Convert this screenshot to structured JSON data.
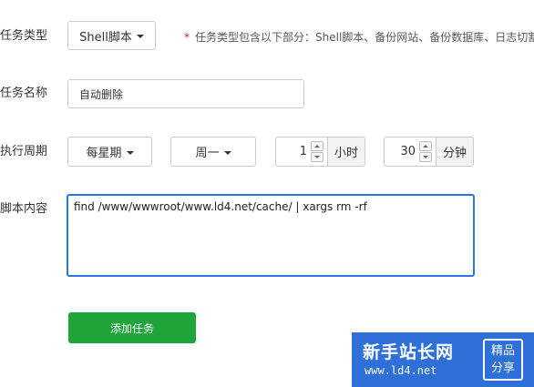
{
  "form": {
    "task_type": {
      "label": "任务类型",
      "value": "Shell脚本",
      "hint_star": "*",
      "hint": "任务类型包含以下部分：Shell脚本、备份网站、备份数据库、日志切割"
    },
    "task_name": {
      "label": "任务名称",
      "value": "自动删除"
    },
    "cycle": {
      "label": "执行周期",
      "period": "每星期",
      "weekday": "周一",
      "hour_value": "1",
      "hour_unit": "小时",
      "minute_value": "30",
      "minute_unit": "分钟"
    },
    "script": {
      "label": "脚本内容",
      "value": "find /www/wwwroot/www.ld4.net/cache/ | xargs rm -rf"
    },
    "submit_label": "添加任务"
  },
  "watermark": {
    "title": "新手站长网",
    "url": "www.ld4.net",
    "badge_line1": "精品",
    "badge_line2": "分享",
    "color": "#2e6fd8"
  },
  "colors": {
    "accent": "#20a53a",
    "focus": "#2b74e2",
    "required": "#e02020"
  },
  "icons": {
    "dropdown": "caret-down-icon",
    "spin_up": "spin-up-icon",
    "spin_down": "spin-down-icon"
  }
}
